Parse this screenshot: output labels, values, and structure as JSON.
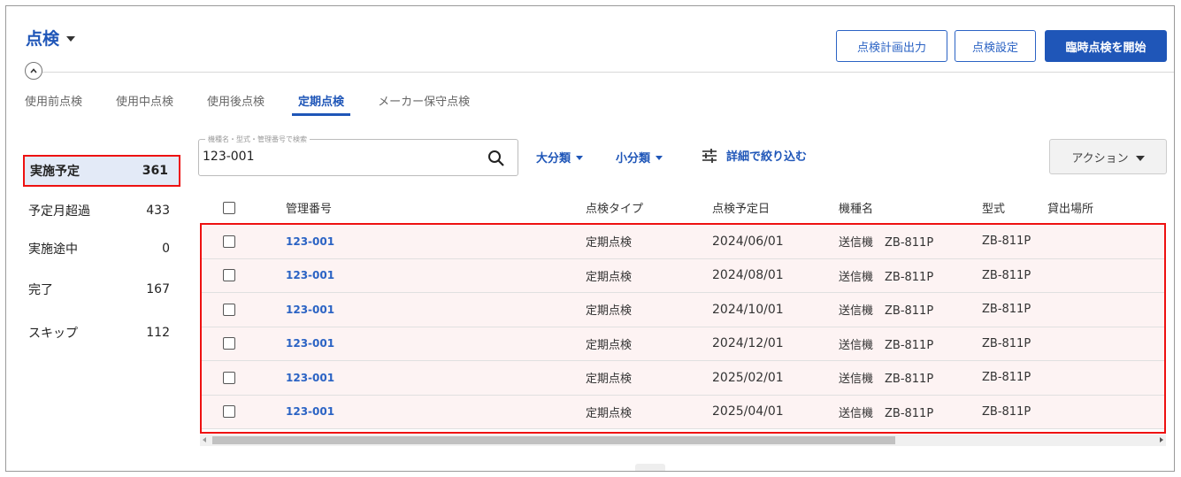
{
  "header": {
    "title": "点検",
    "btn_plan_output": "点検計画出力",
    "btn_settings": "点検設定",
    "btn_start_adhoc": "臨時点検を開始"
  },
  "tabs": [
    {
      "label": "使用前点検",
      "active": false
    },
    {
      "label": "使用中点検",
      "active": false
    },
    {
      "label": "使用後点検",
      "active": false
    },
    {
      "label": "定期点検",
      "active": true
    },
    {
      "label": "メーカー保守点検",
      "active": false
    }
  ],
  "statuses": [
    {
      "label": "実施予定",
      "count": "361",
      "active": true
    },
    {
      "label": "予定月超過",
      "count": "433",
      "active": false
    },
    {
      "label": "実施途中",
      "count": "0",
      "active": false
    },
    {
      "label": "完了",
      "count": "167",
      "active": false
    },
    {
      "label": "スキップ",
      "count": "112",
      "active": false
    }
  ],
  "search": {
    "label": "機種名・型式・管理番号で検索",
    "value": "123-001"
  },
  "filters": {
    "major": "大分類",
    "minor": "小分類",
    "detail": "詳細で絞り込む",
    "action": "アクション"
  },
  "table": {
    "headers": {
      "id": "管理番号",
      "type": "点検タイプ",
      "date": "点検予定日",
      "model_name": "機種名",
      "model": "型式",
      "location": "貸出場所"
    },
    "rows": [
      {
        "id": "123-001",
        "type": "定期点検",
        "date": "2024/06/01",
        "model_name": "送信機　ZB-811P",
        "model": "ZB-811P"
      },
      {
        "id": "123-001",
        "type": "定期点検",
        "date": "2024/08/01",
        "model_name": "送信機　ZB-811P",
        "model": "ZB-811P"
      },
      {
        "id": "123-001",
        "type": "定期点検",
        "date": "2024/10/01",
        "model_name": "送信機　ZB-811P",
        "model": "ZB-811P"
      },
      {
        "id": "123-001",
        "type": "定期点検",
        "date": "2024/12/01",
        "model_name": "送信機　ZB-811P",
        "model": "ZB-811P"
      },
      {
        "id": "123-001",
        "type": "定期点検",
        "date": "2025/02/01",
        "model_name": "送信機　ZB-811P",
        "model": "ZB-811P"
      },
      {
        "id": "123-001",
        "type": "定期点検",
        "date": "2025/04/01",
        "model_name": "送信機　ZB-811P",
        "model": "ZB-811P"
      }
    ]
  },
  "colors": {
    "accent": "#1f56b8",
    "highlight": "#ee1111",
    "row_bg": "#fdf3f3"
  }
}
